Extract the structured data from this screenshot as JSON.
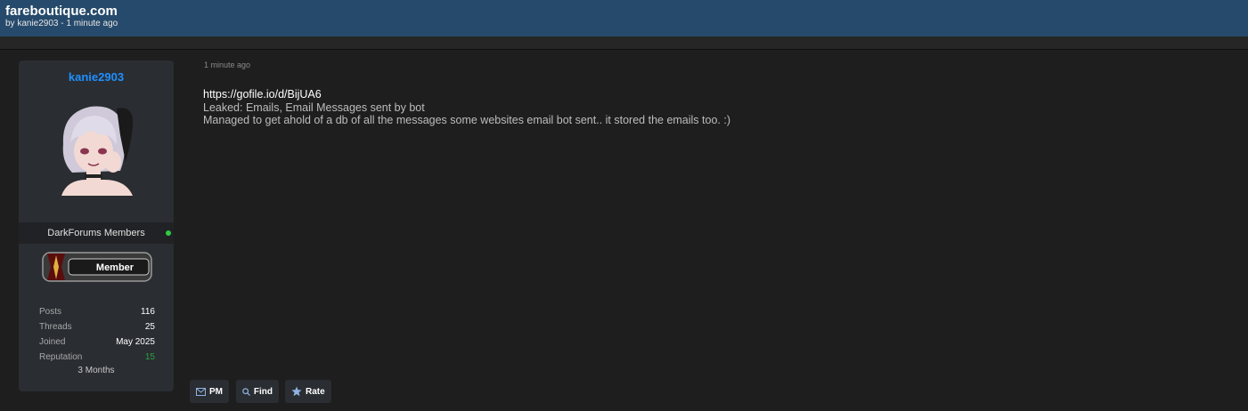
{
  "header": {
    "site_title": "fareboutique.com",
    "byline": "by kanie2903 - 1 minute ago"
  },
  "user": {
    "username": "kanie2903",
    "group": "DarkForums Members",
    "badge_label": "Member",
    "online": true,
    "stats": [
      {
        "label": "Posts",
        "value": "116"
      },
      {
        "label": "Threads",
        "value": "25"
      },
      {
        "label": "Joined",
        "value": "May 2025"
      },
      {
        "label": "Reputation",
        "value": "15"
      }
    ],
    "membership_duration": "3 Months"
  },
  "post": {
    "date": "1 minute ago",
    "link": "https://gofile.io/d/BijUA6",
    "lines": [
      "Leaked: Emails, Email Messages sent by bot",
      "Managed to get ahold of a db of all the messages some websites email bot sent.. it stored the emails too. :)"
    ]
  },
  "actions": {
    "pm_label": "PM",
    "find_label": "Find",
    "rate_label": "Rate"
  },
  "colors": {
    "header_bg": "#264a6b",
    "username": "#1e90ff",
    "online": "#2ecc40",
    "reputation": "#2ea043"
  },
  "icons": {
    "pm": "mail-icon",
    "find": "search-icon",
    "rate": "star-icon"
  }
}
